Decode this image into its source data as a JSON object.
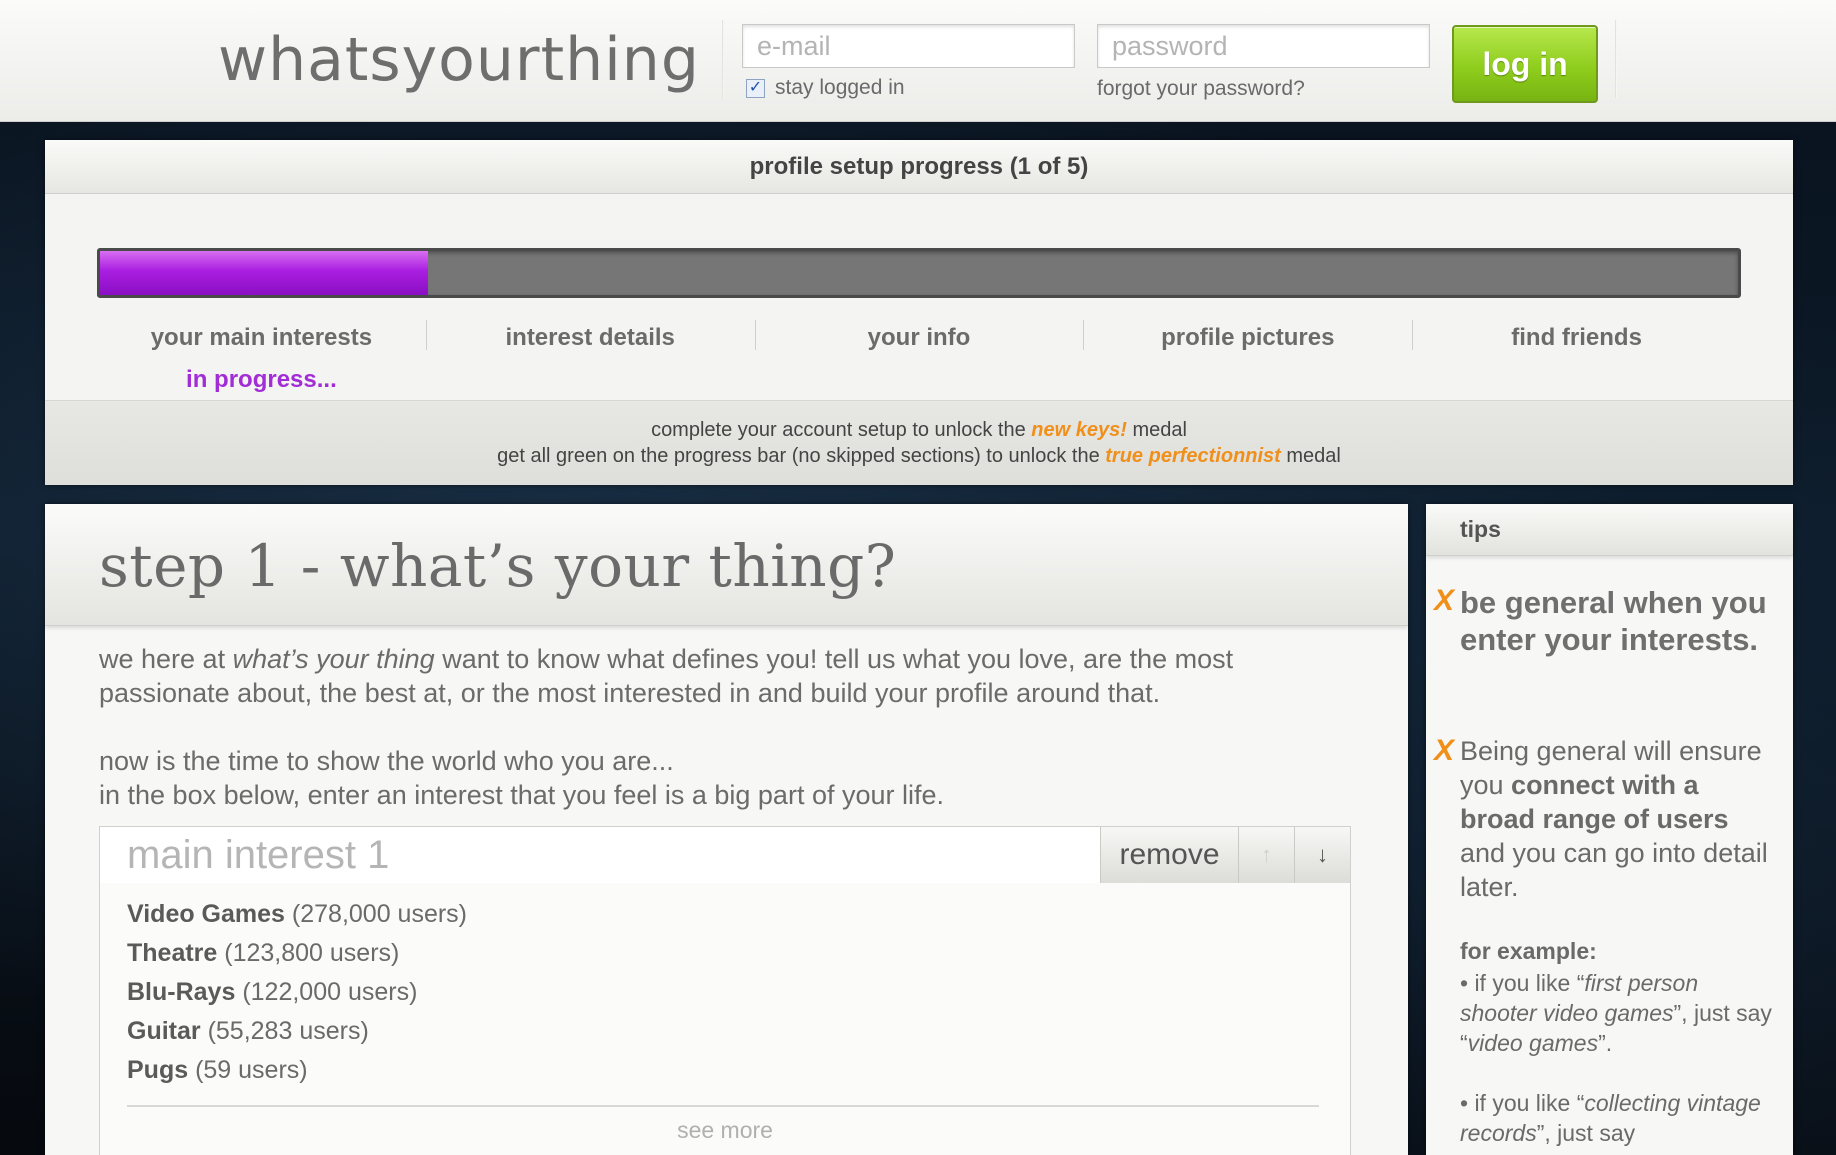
{
  "header": {
    "logo": "whatsyourthing",
    "email_placeholder": "e-mail",
    "password_placeholder": "password",
    "stay_logged_in_label": "stay logged in",
    "stay_logged_in_checked": true,
    "forgot_password_label": "forgot your password?",
    "login_label": "log in",
    "login_color": "#8fcd1d"
  },
  "progress": {
    "title": "profile setup progress (1 of 5)",
    "fraction": 0.2,
    "fill_color": "#a91ee0",
    "steps": [
      {
        "label": "your main interests",
        "status": "in progress..."
      },
      {
        "label": "interest details",
        "status": ""
      },
      {
        "label": "your info",
        "status": ""
      },
      {
        "label": "profile pictures",
        "status": ""
      },
      {
        "label": "find friends",
        "status": ""
      }
    ],
    "medal_line_1": {
      "before": "complete your account setup to unlock the ",
      "medal": "new keys!",
      "after": " medal"
    },
    "medal_line_2": {
      "before": "get all green on the progress bar (no skipped sections) to unlock the ",
      "medal": "true perfectionnist",
      "after": " medal"
    },
    "medal_color": "#f0901b"
  },
  "main": {
    "title": "step 1 - what’s your thing?",
    "intro_a": "we here at ",
    "intro_em": "what’s your thing",
    "intro_b": " want to know what defines you! tell us what you love, are the most passionate about, the best at, or the most interested in and build your profile around that.",
    "intro_line_2": "now is the time to show the world who you are...",
    "intro_line_3": "in the box below, enter an interest that you feel is a big part of your life.",
    "interest_placeholder": "main interest 1",
    "remove_label": "remove",
    "up_arrow": "↑",
    "down_arrow": "↓",
    "suggestions": [
      {
        "name": "Video Games",
        "count": "(278,000 users)"
      },
      {
        "name": "Theatre",
        "count": "(123,800 users)"
      },
      {
        "name": "Blu-Rays",
        "count": "(122,000 users)"
      },
      {
        "name": "Guitar",
        "count": "(55,283 users)"
      },
      {
        "name": "Pugs",
        "count": "(59 users)"
      }
    ],
    "see_more_label": "see more"
  },
  "tips": {
    "title": "tips",
    "marker": "X",
    "tip_1": "be general when you enter your interests.",
    "tip_2_a": "Being general will ensure you ",
    "tip_2_b": "connect with a broad range of users",
    "tip_2_c": " and you can go into detail later.",
    "example_head": "for example:",
    "example_1_a": "• if you like “",
    "example_1_b": "first person shooter video games",
    "example_1_c": "”, just say “",
    "example_1_d": "video games",
    "example_1_e": "”.",
    "example_2_a": "• if you like “",
    "example_2_b": "collecting vintage records",
    "example_2_c": "”, just say"
  }
}
